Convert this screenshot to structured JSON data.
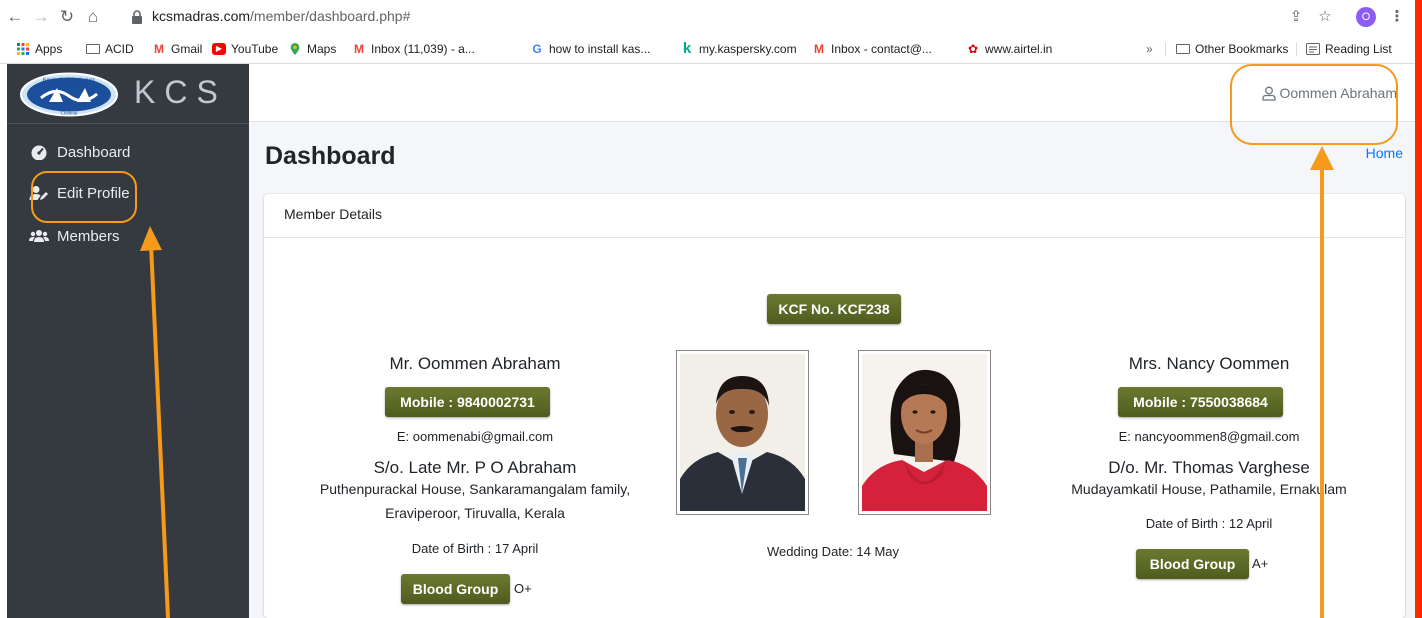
{
  "browser": {
    "url_domain": "kcsmadras.com",
    "url_path": "/member/dashboard.php#",
    "profile_initial": "O",
    "bookmarks": [
      {
        "label": "Apps",
        "icon": "apps-grid-icon"
      },
      {
        "label": "ACID",
        "icon": "folder-icon"
      },
      {
        "label": "Gmail",
        "icon": "gmail-icon"
      },
      {
        "label": "YouTube",
        "icon": "youtube-icon"
      },
      {
        "label": "Maps",
        "icon": "maps-pin-icon"
      },
      {
        "label": "Inbox (11,039) - a...",
        "icon": "gmail-icon"
      },
      {
        "label": "how to install kas...",
        "icon": "google-icon"
      },
      {
        "label": "my.kaspersky.com",
        "icon": "kaspersky-icon"
      },
      {
        "label": "Inbox - contact@...",
        "icon": "gmail-icon"
      },
      {
        "label": "www.airtel.in",
        "icon": "airtel-icon"
      }
    ],
    "overflow": "»",
    "other_bookmarks": "Other Bookmarks",
    "reading_list": "Reading List"
  },
  "app": {
    "brand": "KCS",
    "logo_text": "Kerala Catholic Society",
    "logo_subtext": "Chennai",
    "user_name": "Oommen Abraham",
    "nav": [
      {
        "label": "Dashboard",
        "icon": "speedometer-icon"
      },
      {
        "label": "Edit Profile",
        "icon": "user-edit-icon"
      },
      {
        "label": "Members",
        "icon": "users-icon"
      }
    ],
    "page_title": "Dashboard",
    "breadcrumb": "Home",
    "card_title": "Member Details",
    "kcf_no": "KCF No. KCF238",
    "member": {
      "name": "Mr. Oommen Abraham",
      "mobile": "Mobile : 9840002731",
      "email": "E: oommenabi@gmail.com",
      "parent": "S/o. Late Mr. P O Abraham",
      "address_1": "Puthenpurackal House, Sankaramangalam family,",
      "address_2": "Eraviperoor, Tiruvalla, Kerala",
      "dob": "Date of Birth : 17 April",
      "blood_label": "Blood Group",
      "blood_value": "O+"
    },
    "spouse": {
      "name": "Mrs. Nancy Oommen",
      "mobile": "Mobile : 7550038684",
      "email": "E: nancyoommen8@gmail.com",
      "parent": "D/o. Mr. Thomas Varghese",
      "address_1": "Mudayamkatil House, Pathamile, Ernakulam",
      "dob": "Date of Birth : 12 April",
      "blood_label": "Blood Group",
      "blood_value": "A+"
    },
    "wedding": "Wedding Date: 14 May"
  },
  "colors": {
    "sidebar": "#343a40",
    "badge": "#5d6a26",
    "annotation": "#f59a1b",
    "link": "#007bff"
  }
}
